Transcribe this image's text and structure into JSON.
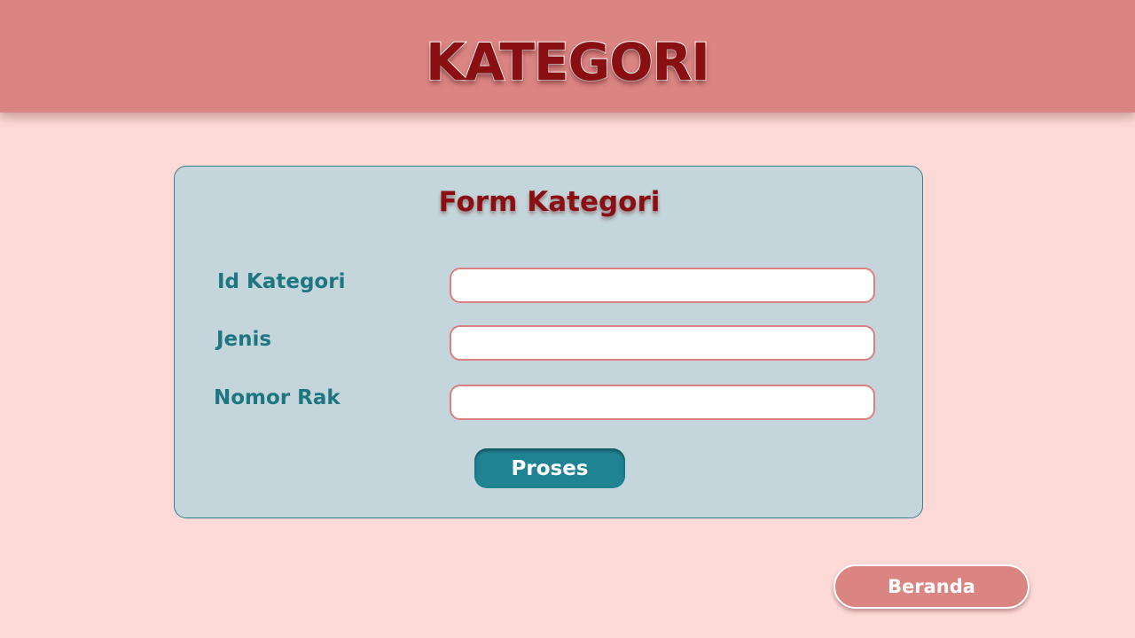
{
  "header": {
    "title": "KATEGORI"
  },
  "form": {
    "title": "Form Kategori",
    "fields": [
      {
        "label": "Id Kategori",
        "value": "",
        "placeholder": ""
      },
      {
        "label": "Jenis",
        "value": "",
        "placeholder": ""
      },
      {
        "label": "Nomor Rak",
        "value": "",
        "placeholder": ""
      }
    ],
    "submit_label": "Proses"
  },
  "nav": {
    "home_label": "Beranda"
  },
  "colors": {
    "background": "#fdd9d7",
    "header": "#db8583",
    "title_text": "#8a0f12",
    "card": "#c4d6db",
    "label_text": "#1e7680",
    "primary_button": "#1f8392",
    "input_border": "#d98080"
  }
}
